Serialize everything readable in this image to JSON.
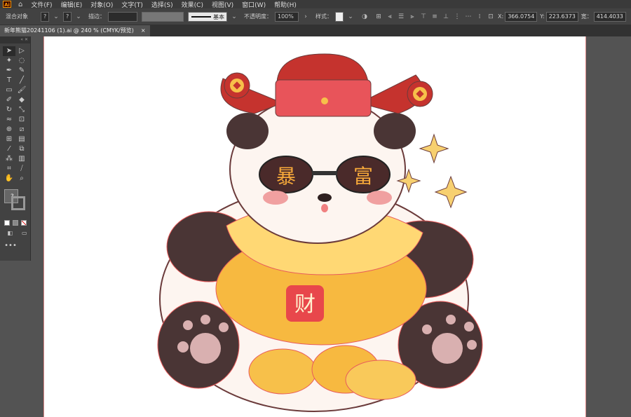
{
  "app_logo": "Ai",
  "menu": [
    "文件(F)",
    "编辑(E)",
    "对象(O)",
    "文字(T)",
    "选择(S)",
    "效果(C)",
    "视图(V)",
    "窗口(W)",
    "帮助(H)"
  ],
  "control_bar": {
    "selection_label": "混合对象",
    "stroke_label": "描边：",
    "stroke_style": "基本",
    "opacity_label": "不透明度：",
    "opacity_value": "100%",
    "style_label": "样式：",
    "x_label": "X:",
    "x_value": "366.0754",
    "y_label": "Y:",
    "y_value": "223.6373",
    "w_label": "宽：",
    "w_value": "414.4033"
  },
  "document_tab": {
    "title": "新年熊猫20241106 (1).ai @ 240 % (CMYK/预览)",
    "close": "×"
  },
  "artwork": {
    "left_char": "暴",
    "right_char": "富",
    "ingot_char": "财"
  },
  "colors": {
    "panda_dark": "#4a3535",
    "hat_red": "#d7453f",
    "gold": "#f7c04a",
    "outline": "#e85b5b",
    "cheek": "#f0a0a0"
  }
}
